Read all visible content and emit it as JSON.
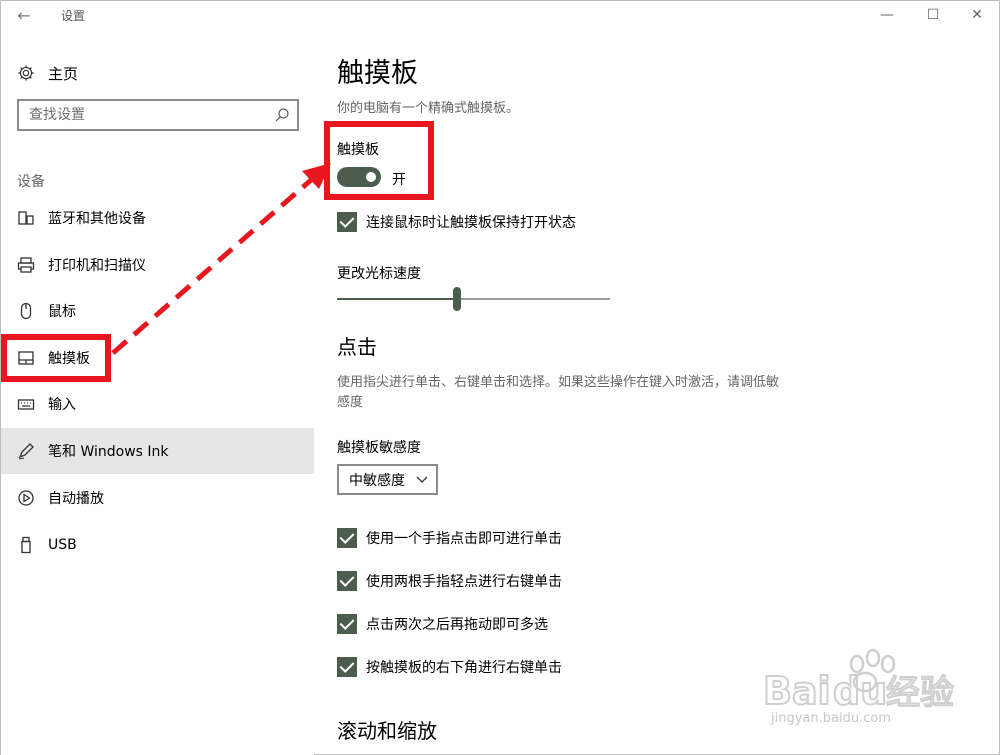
{
  "window": {
    "title": "设置",
    "back_glyph": "←",
    "min_glyph": "—",
    "max_glyph": "☐",
    "close_glyph": "✕"
  },
  "sidebar": {
    "home_label": "主页",
    "search_placeholder": "查找设置",
    "section_label": "设备",
    "items": [
      {
        "label": "蓝牙和其他设备",
        "icon": "bluetooth-devices-icon"
      },
      {
        "label": "打印机和扫描仪",
        "icon": "printer-icon"
      },
      {
        "label": "鼠标",
        "icon": "mouse-icon"
      },
      {
        "label": "触摸板",
        "icon": "touchpad-icon"
      },
      {
        "label": "输入",
        "icon": "keyboard-icon"
      },
      {
        "label": "笔和 Windows Ink",
        "icon": "pen-icon"
      },
      {
        "label": "自动播放",
        "icon": "autoplay-icon"
      },
      {
        "label": "USB",
        "icon": "usb-icon"
      }
    ]
  },
  "main": {
    "title": "触摸板",
    "subtitle": "你的电脑有一个精确式触摸板。",
    "toggle_label": "触摸板",
    "toggle_state": "开",
    "toggle_on": true,
    "keep_on_with_mouse": "连接鼠标时让触摸板保持打开状态",
    "cursor_speed_label": "更改光标速度",
    "cursor_speed_fraction": 0.44,
    "taps_heading": "点击",
    "taps_desc": "使用指尖进行单击、右键单击和选择。如果这些操作在键入时激活，请调低敏感度",
    "sensitivity_label": "触摸板敏感度",
    "sensitivity_value": "中敏感度",
    "checks": [
      "使用一个手指点击即可进行单击",
      "使用两根手指轻点进行右键单击",
      "点击两次之后再拖动即可多选",
      "按触摸板的右下角进行右键单击"
    ],
    "scroll_heading": "滚动和缩放"
  },
  "colors": {
    "accent": "#4d5d4d",
    "annotation_red": "#e8161e",
    "hover_bg": "#e6e6e6"
  },
  "watermark": {
    "brand": "Baidu经验",
    "domain": "jingyan.baidu.com"
  }
}
